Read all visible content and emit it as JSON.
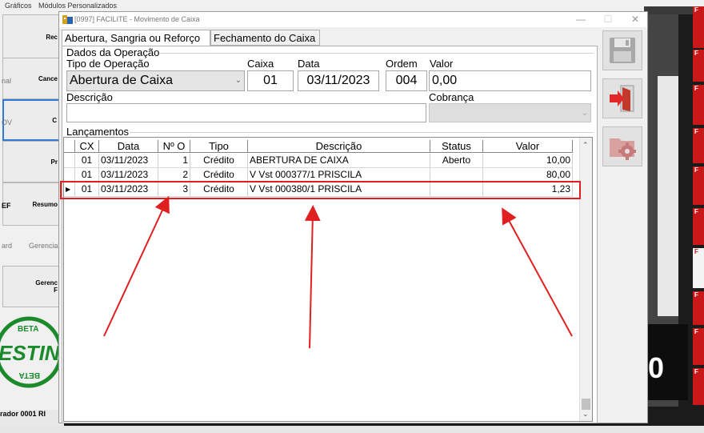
{
  "background": {
    "menu": [
      "Gráficos",
      "Módulos Personalizados"
    ],
    "buttons": [
      "Rec",
      "Cance",
      "C",
      "Pr",
      "Resumo",
      "Gerenc\nF"
    ],
    "side_labels": [
      "nal",
      "OV",
      "EF",
      "ard",
      "Gerencia"
    ],
    "stamp_text": [
      "BETA",
      "ESTIN",
      "BETA"
    ],
    "status_text": "rador 0001  RI",
    "right_big_digit": "0",
    "right_red_labels": [
      "F",
      "F",
      "F",
      "F",
      "F",
      "F",
      "F",
      "F",
      "F",
      "F",
      "A"
    ]
  },
  "dialog": {
    "title": "[0997] FACILITE - Movimento de Caixa",
    "win_min": "—",
    "win_max": "☐",
    "win_close": "✕",
    "tabs": [
      {
        "label": "Abertura, Sangria ou Reforço",
        "selected": true
      },
      {
        "label": "Fechamento do Caixa",
        "selected": false
      }
    ],
    "dados": {
      "group_title": "Dados da Operação",
      "tipo_label": "Tipo de Operação",
      "tipo_value": "Abertura de Caixa",
      "caixa_label": "Caixa",
      "caixa_value": "01",
      "data_label": "Data",
      "data_value": "03/11/2023",
      "ordem_label": "Ordem",
      "ordem_value": "004",
      "valor_label": "Valor",
      "valor_value": "0,00",
      "descricao_label": "Descrição",
      "descricao_value": "",
      "cobranca_label": "Cobrança",
      "cobranca_value": ""
    },
    "lancamentos": {
      "group_title": "Lançamentos",
      "columns": [
        "CX",
        "Data",
        "Nº O",
        "Tipo",
        "Descrição",
        "Status",
        "Valor"
      ],
      "rows": [
        {
          "cx": "01",
          "data": "03/11/2023",
          "num": "1",
          "tipo": "Crédito",
          "descricao": "ABERTURA DE CAIXA",
          "status": "Aberto",
          "valor": "10,00",
          "current": false
        },
        {
          "cx": "01",
          "data": "03/11/2023",
          "num": "2",
          "tipo": "Crédito",
          "descricao": "V Vst 000377/1 PRISCILA",
          "status": "",
          "valor": "80,00",
          "current": false
        },
        {
          "cx": "01",
          "data": "03/11/2023",
          "num": "3",
          "tipo": "Crédito",
          "descricao": "V Vst 000380/1 PRISCILA",
          "status": "",
          "valor": "1,23",
          "current": true
        }
      ]
    },
    "toolbar": [
      {
        "icon": "floppy-disk-icon",
        "enabled": false
      },
      {
        "icon": "exit-door-icon",
        "enabled": true
      },
      {
        "icon": "folder-gear-icon",
        "enabled": false
      }
    ]
  },
  "colors": {
    "highlight": "#e02020",
    "accent_red": "#c81818",
    "stamp_green": "#1a8a2a"
  }
}
